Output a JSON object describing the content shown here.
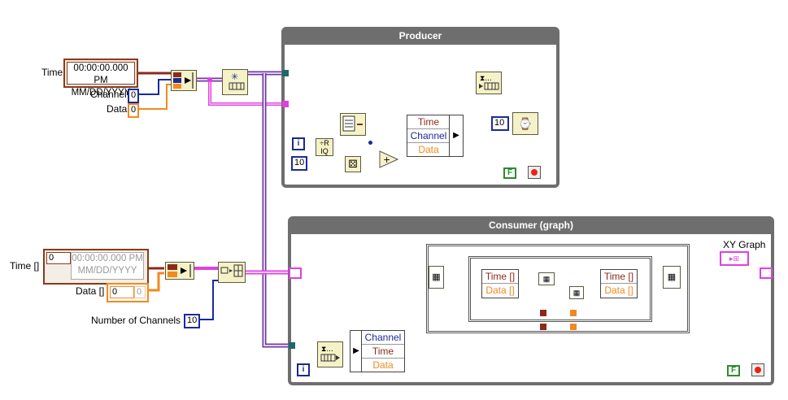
{
  "producer": {
    "title": "Producer",
    "bundle_rows": [
      "Time",
      "Channel",
      "Data"
    ],
    "wait_ms": "10",
    "random_count": "10",
    "stop_constant": "F",
    "iteration_label": "i"
  },
  "consumer": {
    "title": "Consumer (graph)",
    "unbundle_rows": [
      "Channel",
      "Time",
      "Data"
    ],
    "inner_bundle_left": [
      "Time []",
      "Data []"
    ],
    "inner_bundle_right": [
      "Time []",
      "Data []"
    ],
    "stop_constant": "F",
    "iteration_label": "i",
    "xy_graph_label": "XY Graph"
  },
  "inputs": {
    "time_label": "Time",
    "time_value_line1": "00:00:00.000 PM",
    "time_value_line2": "MM/DD/YYYY",
    "channel_label": "Channel",
    "channel_value": "0",
    "data_label": "Data",
    "data_value": "0",
    "time_array_label": "Time []",
    "time_array_index": "0",
    "time_array_value_line1": "00:00:00.000 PM",
    "time_array_value_line2": "MM/DD/YYYY",
    "data_array_label": "Data []",
    "data_array_index": "0",
    "data_array_value": "0",
    "num_channels_label": "Number of Channels",
    "num_channels_value": "10"
  },
  "colors": {
    "wire_pink": "#e040e0",
    "wire_blue": "#1a2a9c",
    "wire_brown": "#8b2a1a",
    "wire_orange": "#f08a20",
    "structure_gray": "#6e6e6e",
    "node_fill": "#f6f2c8"
  }
}
